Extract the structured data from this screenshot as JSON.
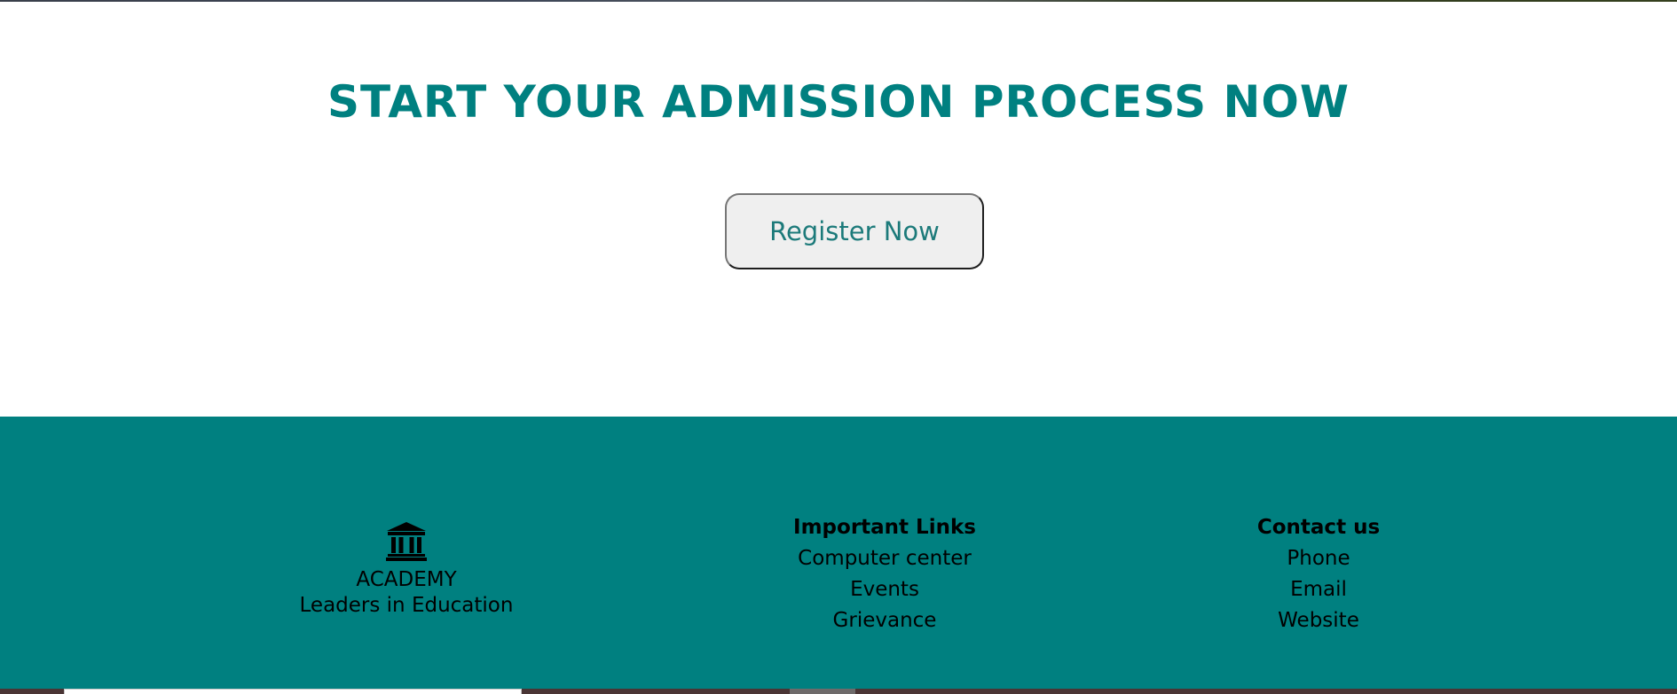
{
  "cta": {
    "title": "START YOUR ADMISSION PROCESS NOW",
    "register_label": "Register Now"
  },
  "footer": {
    "brand": {
      "icon": "bank-icon",
      "name": "ACADEMY",
      "tagline": "Leaders in Education"
    },
    "important_links": {
      "heading": "Important Links",
      "items": [
        "Computer center",
        "Events",
        "Grievance"
      ]
    },
    "contact": {
      "heading": "Contact us",
      "items": [
        "Phone",
        "Email",
        "Website"
      ]
    }
  },
  "colors": {
    "accent": "#008080",
    "button_bg": "#efefef",
    "footer_text": "#000000"
  }
}
